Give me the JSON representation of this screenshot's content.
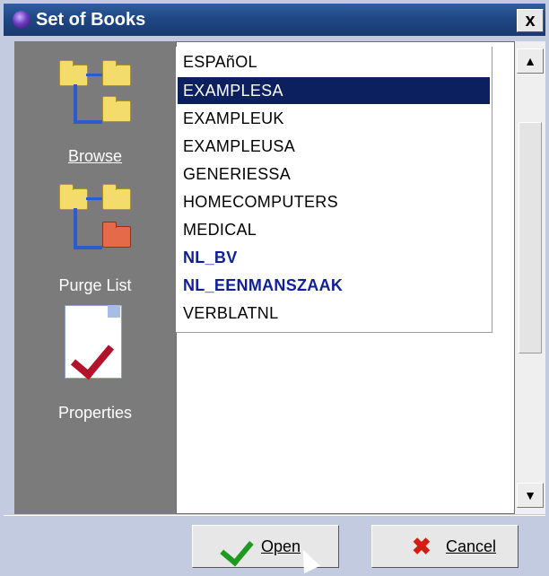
{
  "window": {
    "title": "Set of Books",
    "close_label": "x"
  },
  "sidebar": {
    "items": [
      {
        "label": "Browse",
        "icon": "folder-tree-icon"
      },
      {
        "label": "Purge List",
        "icon": "folder-tree-red-icon"
      },
      {
        "label": "Properties",
        "icon": "properties-check-icon"
      }
    ]
  },
  "books": {
    "items": [
      {
        "label": "ESPAñOL",
        "state": "normal"
      },
      {
        "label": "EXAMPLESA",
        "state": "selected"
      },
      {
        "label": "EXAMPLEUK",
        "state": "normal"
      },
      {
        "label": "EXAMPLEUSA",
        "state": "normal"
      },
      {
        "label": "GENERIESSA",
        "state": "normal"
      },
      {
        "label": "HOMECOMPUTERS",
        "state": "normal"
      },
      {
        "label": "MEDICAL",
        "state": "normal"
      },
      {
        "label": "NL_BV",
        "state": "bold"
      },
      {
        "label": "NL_EENMANSZAAK",
        "state": "bold"
      },
      {
        "label": "VERBLATNL",
        "state": "normal"
      }
    ]
  },
  "scrollbar": {
    "up_glyph": "▲",
    "down_glyph": "▼"
  },
  "buttons": {
    "open_label": "Open",
    "cancel_label": "Cancel"
  },
  "colors": {
    "selection": "#0c2060",
    "bold_entry": "#10209a",
    "sidebar": "#7b7b7b"
  }
}
